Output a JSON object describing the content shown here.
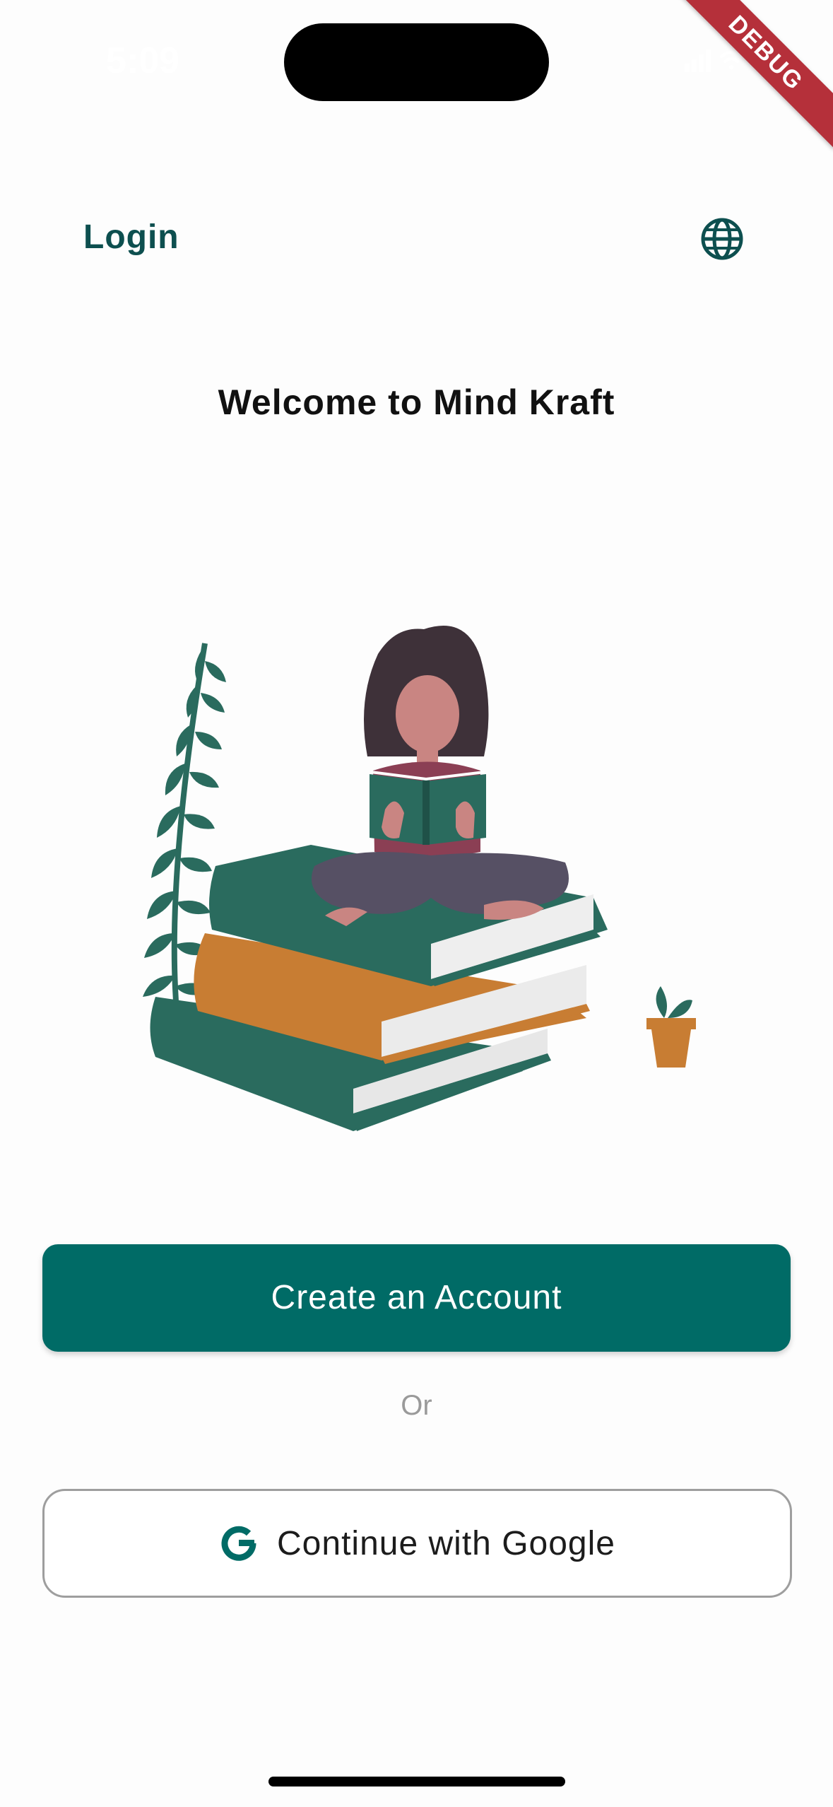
{
  "status_bar": {
    "time": "5:09"
  },
  "debug_banner": {
    "label": "DEBUG"
  },
  "header": {
    "title": "Login",
    "globe_icon": "globe-icon"
  },
  "welcome": {
    "title": "Welcome to Mind Kraft"
  },
  "illustration": {
    "name": "reading-on-books-illustration"
  },
  "actions": {
    "create_account_label": "Create an Account",
    "separator": "Or",
    "google_label": "Continue with Google",
    "google_icon": "google-g-icon"
  },
  "colors": {
    "primary": "#006b66",
    "header_text": "#0d4f4f",
    "debug_banner": "#b5303a",
    "book_orange": "#c87d33"
  }
}
